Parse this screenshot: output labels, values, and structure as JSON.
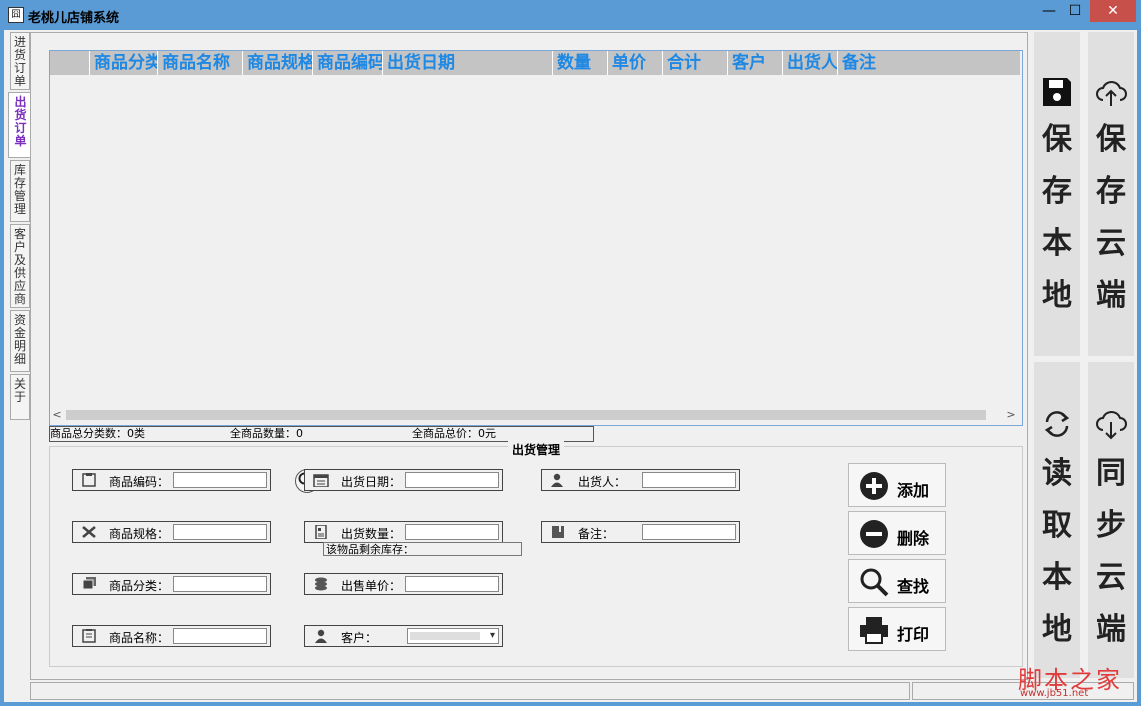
{
  "window": {
    "title": "老桃儿店铺系统",
    "app_icon_glyph": "囧",
    "minimize_glyph": "—",
    "maximize_glyph": "☐",
    "close_glyph": "✕"
  },
  "side_tabs": [
    {
      "label": "进货订单"
    },
    {
      "label": "出货订单"
    },
    {
      "label": "库存管理"
    },
    {
      "label": "客户及供应商"
    },
    {
      "label": "资金明细"
    },
    {
      "label": "关于"
    }
  ],
  "grid": {
    "columns": [
      "",
      "商品分类",
      "商品名称",
      "商品规格",
      "商品编码",
      "出货日期",
      "数量",
      "单价",
      "合计",
      "客户",
      "出货人",
      "备注"
    ],
    "rows": [],
    "scroll_left": "<",
    "scroll_right": ">"
  },
  "summary": {
    "category_count": "商品总分类数：0类",
    "quantity": "全商品数量：0",
    "total_price": "全商品总价：0元"
  },
  "panel": {
    "title": "出货管理",
    "fields": {
      "code": {
        "label": "商品编码："
      },
      "spec": {
        "label": "商品规格："
      },
      "category": {
        "label": "商品分类："
      },
      "name": {
        "label": "商品名称："
      },
      "date": {
        "label": "出货日期："
      },
      "qty": {
        "label": "出货数量："
      },
      "price": {
        "label": "出售单价："
      },
      "customer": {
        "label": "客户："
      },
      "shipper": {
        "label": "出货人："
      },
      "note": {
        "label": "备注："
      }
    },
    "stock_hint": "该物品剩余库存：",
    "customer_arrow": "▾"
  },
  "actions": {
    "add": "添加",
    "delete": "删除",
    "find": "查找",
    "print": "打印"
  },
  "right_panel": {
    "save_local": [
      "保",
      "存",
      "本",
      "地"
    ],
    "save_cloud": [
      "保",
      "存",
      "云",
      "端"
    ],
    "read_local": [
      "读",
      "取",
      "本",
      "地"
    ],
    "sync_cloud": [
      "同",
      "步",
      "云",
      "端"
    ]
  },
  "watermark": {
    "main": "脚本之家",
    "sub": "www.jb51.net"
  },
  "colors": {
    "header_text": "#1e88e5",
    "active_tab": "#7a2fbf",
    "title_bar": "#5b9bd5",
    "close": "#c7504b"
  }
}
